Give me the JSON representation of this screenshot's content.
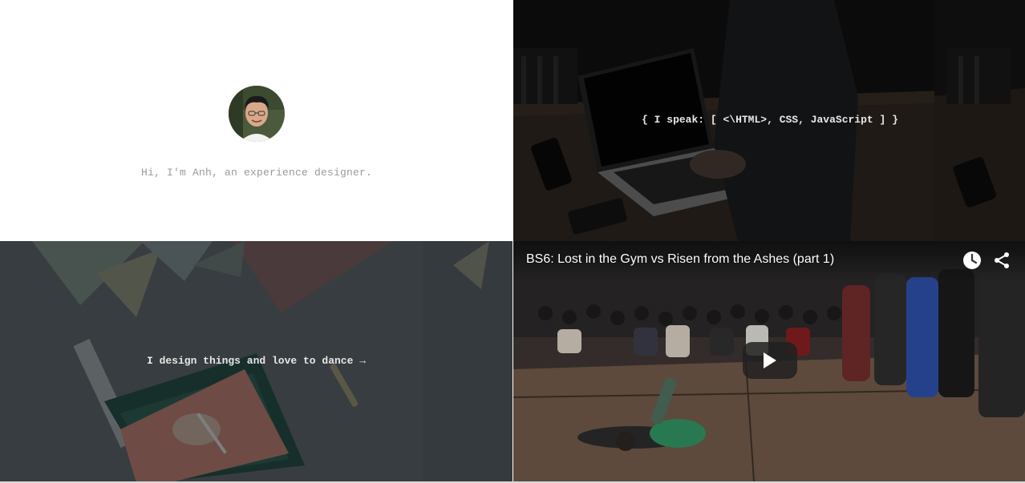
{
  "intro": {
    "text": "Hi, I'm Anh, an experience designer.",
    "avatar_icon": "profile-photo"
  },
  "code_tile": {
    "text": "{ I speak: [ <\\HTML>, CSS, JavaScript ] }"
  },
  "design_tile": {
    "text": "I design things and love to dance →"
  },
  "video": {
    "title": "BS6: Lost in the Gym vs Risen from the Ashes (part 1)",
    "watch_later_icon": "clock-icon",
    "share_icon": "share-icon",
    "play_icon": "play-icon"
  },
  "colors": {
    "intro_text": "#9a9a9a",
    "overlay_text": "#e6e6e6",
    "play_button": "#212121"
  }
}
